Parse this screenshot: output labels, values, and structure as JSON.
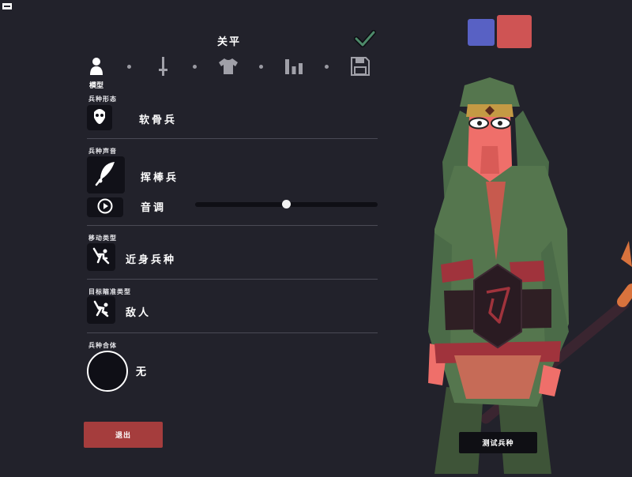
{
  "header": {
    "title": "关平"
  },
  "colors": {
    "team_blue": "#5861c4",
    "team_red": "#cf5454",
    "exit_button": "#a53d3d",
    "background": "#22222b"
  },
  "tabs": [
    {
      "icon": "person-icon",
      "label": "模型",
      "selected": true
    },
    {
      "icon": "sword-icon"
    },
    {
      "icon": "shirt-icon"
    },
    {
      "icon": "bar-stats-icon"
    },
    {
      "icon": "save-icon"
    }
  ],
  "unit_model": {
    "label": "兵种形态",
    "value": "软骨兵",
    "icon": "skull-mask-icon"
  },
  "unit_voice": {
    "label": "兵种声音",
    "value": "挥棒兵",
    "icon": "feather-icon",
    "pitch_label": "音调",
    "pitch_value": 0.5,
    "play_icon": "play-icon"
  },
  "movement": {
    "label": "移动类型",
    "value": "近身兵种",
    "icon": "melee-unit-icon"
  },
  "targeting": {
    "label": "目标瞄准类型",
    "value": "敌人",
    "icon": "target-enemy-icon"
  },
  "combine": {
    "label": "兵种合体",
    "value": "无"
  },
  "buttons": {
    "exit": "退出",
    "test_unit": "测试兵种"
  }
}
